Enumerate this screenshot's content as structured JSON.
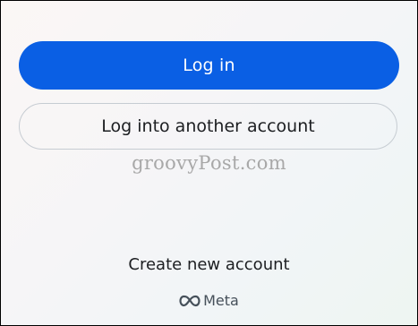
{
  "login": {
    "primary_label": "Log in",
    "secondary_label": "Log into another account"
  },
  "watermark": {
    "text": "groovyPost.com"
  },
  "footer": {
    "create_account_label": "Create new account",
    "brand_icon": "meta-infinity-icon",
    "brand_label": "Meta"
  },
  "colors": {
    "primary": "#0a5fe4",
    "text": "#1c1e21",
    "border": "#c6ccd2"
  }
}
